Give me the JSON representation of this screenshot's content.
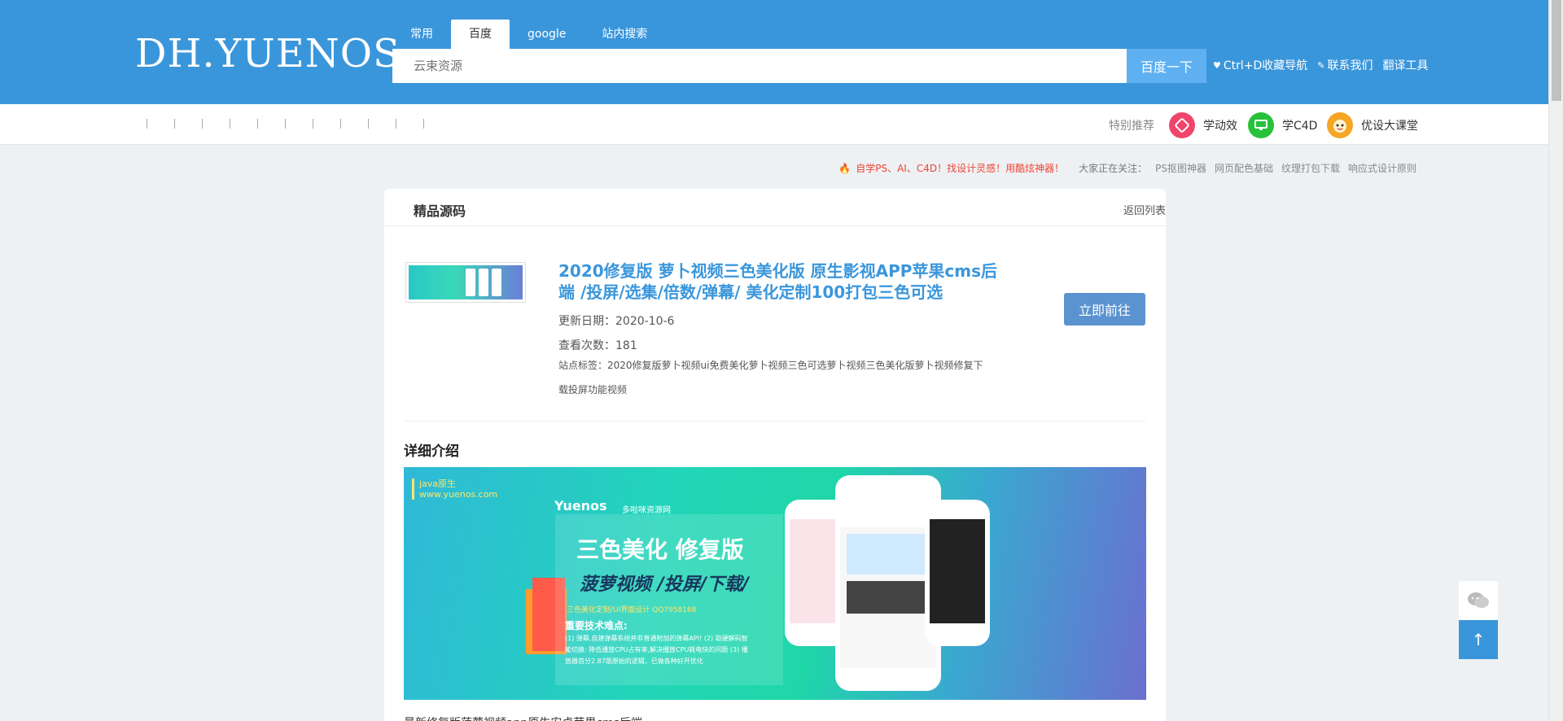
{
  "header": {
    "logo": "DH.YUENOS",
    "tabs": [
      {
        "label": "常用"
      },
      {
        "label": "百度"
      },
      {
        "label": "google"
      },
      {
        "label": "站内搜索"
      }
    ],
    "active_tab": "百度",
    "search": {
      "placeholder": "云束资源",
      "button_label": "百度一下"
    },
    "links": [
      {
        "icon": "heart-icon",
        "label": "Ctrl+D收藏导航"
      },
      {
        "icon": "pen-icon",
        "label": "联系我们"
      },
      {
        "icon": "",
        "label": "翻译工具"
      }
    ]
  },
  "navbar": {
    "featured_label": "特别推荐",
    "featured": [
      {
        "label": "学动效",
        "icon": "film-icon",
        "color": "#f0456a"
      },
      {
        "label": "学C4D",
        "icon": "monitor-icon",
        "color": "#27c23a"
      },
      {
        "label": "优设大课堂",
        "icon": "mascot-icon",
        "color": "#f5a623"
      }
    ]
  },
  "notice": {
    "hot_text": "自学PS、AI、C4D！找设计灵感！用酷炫神器！",
    "follow_label": "大家正在关注：",
    "links": [
      "PS抠图神器",
      "网页配色基础",
      "纹理打包下载",
      "响应式设计原则"
    ]
  },
  "card": {
    "section_title": "精品源码",
    "back_label": "返回列表",
    "item": {
      "title": "2020修复版 萝卜视频三色美化版 原生影视APP苹果cms后端 /投屏/选集/倍数/弹幕/ 美化定制100打包三色可选",
      "update_date": "更新日期：2020-10-6",
      "views": "查看次数：181",
      "tags": "站点标签：2020修复版萝卜视频ui免费美化萝卜视频三色可选萝卜视频三色美化版萝卜视频修复下载投屏功能视频",
      "go_label": "立即前往"
    },
    "detail_title": "详细介绍",
    "banner": {
      "brand_line1": "java原生",
      "brand_line2": "www.yuenos.com",
      "logo_text": "Yuenos",
      "logo_sub": "多啦咪资源网",
      "headline1": "三色美化 修复版",
      "headline2": "菠萝视频 /投屏/下载/",
      "small_note": "三色美化定制/UI界面设计 QQ7958168",
      "tech_title": "重要技术难点:",
      "tech_points": "(1) 弹幕,自建弹幕系统并非普通附加的弹幕API! (2) 取硬解码智能切换: 降低播放CPU占有率,解决播放CPU耗电快的问题 (3) 播放器首分2.87版原始的逻辑，已做各种好开优化"
    },
    "body_text": "最新修复版菠萝视频app原生安卓苹果cms后端"
  },
  "float": {
    "wechat_icon": "wechat-icon",
    "top_icon": "arrow-up-icon"
  }
}
